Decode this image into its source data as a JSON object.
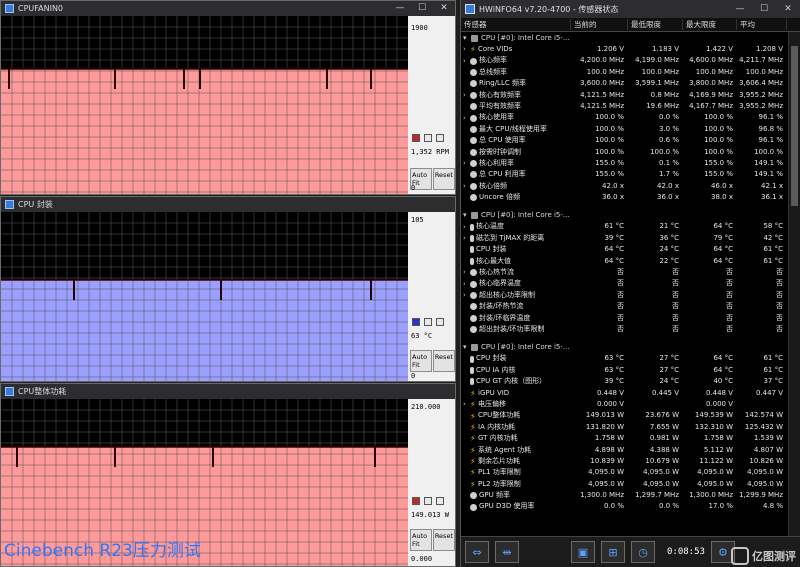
{
  "graphs": [
    {
      "title": "CPUFANIN0",
      "scale_max": "1900",
      "current": "1,352 RPM",
      "scale_min": "0",
      "color": "#ff9a9a",
      "level": 0.7,
      "spikes": [
        0.02,
        0.28,
        0.45,
        0.49,
        0.8,
        0.91
      ]
    },
    {
      "title": "CPU 封装",
      "scale_max": "105",
      "current": "63 °C",
      "scale_min": "0",
      "color": "#9ba0ff",
      "level": 0.6,
      "spikes": [
        0.18,
        0.54,
        0.91
      ]
    },
    {
      "title": "CPU整体功耗",
      "scale_max": "210.000",
      "current": "149.013 W",
      "scale_min": "0.000",
      "color": "#ff9a9a",
      "level": 0.71,
      "spikes": [
        0.04,
        0.28,
        0.52,
        0.92
      ]
    }
  ],
  "graph_buttons": {
    "autofit": "Auto Fit",
    "reset": "Reset"
  },
  "sensor_window": {
    "title": "HWiNFO64 v7.20-4700 - 传感器状态",
    "columns": [
      "传感器",
      "当前的",
      "最低限度",
      "最大限度",
      "平均"
    ],
    "groups": [
      {
        "header": "CPU [#0]: Intel Core i5-...",
        "rows": [
          {
            "icon": "volt",
            "label": "Core VIDs",
            "expand": true,
            "v": [
              "1.206 V",
              "1.183 V",
              "1.422 V",
              "1.208 V"
            ]
          },
          {
            "icon": "circle",
            "label": "核心频率",
            "expand": true,
            "v": [
              "4,200.0 MHz",
              "4,199.0 MHz",
              "4,600.0 MHz",
              "4,211.7 MHz"
            ]
          },
          {
            "icon": "circle",
            "label": "总线频率",
            "expand": false,
            "v": [
              "100.0 MHz",
              "100.0 MHz",
              "100.0 MHz",
              "100.0 MHz"
            ]
          },
          {
            "icon": "circle",
            "label": "Ring/LLC 频率",
            "expand": false,
            "v": [
              "3,600.0 MHz",
              "3,599.1 MHz",
              "3,800.0 MHz",
              "3,606.4 MHz"
            ]
          },
          {
            "icon": "circle",
            "label": "核心有效频率",
            "expand": true,
            "v": [
              "4,121.5 MHz",
              "0.8 MHz",
              "4,169.9 MHz",
              "3,955.2 MHz"
            ]
          },
          {
            "icon": "circle",
            "label": "平均有效频率",
            "expand": false,
            "v": [
              "4,121.5 MHz",
              "19.6 MHz",
              "4,167.7 MHz",
              "3,955.2 MHz"
            ]
          },
          {
            "icon": "circle",
            "label": "核心使用率",
            "expand": true,
            "v": [
              "100.0 %",
              "0.0 %",
              "100.0 %",
              "96.1 %"
            ]
          },
          {
            "icon": "circle",
            "label": "最大 CPU/线程使用率",
            "expand": false,
            "v": [
              "100.0 %",
              "3.0 %",
              "100.0 %",
              "96.8 %"
            ]
          },
          {
            "icon": "circle",
            "label": "总 CPU 使用率",
            "expand": false,
            "v": [
              "100.0 %",
              "0.6 %",
              "100.0 %",
              "96.1 %"
            ]
          },
          {
            "icon": "circle",
            "label": "按需时钟调制",
            "expand": false,
            "v": [
              "100.0 %",
              "100.0 %",
              "100.0 %",
              "100.0 %"
            ]
          },
          {
            "icon": "circle",
            "label": "核心利用率",
            "expand": true,
            "v": [
              "155.0 %",
              "0.1 %",
              "155.0 %",
              "149.1 %"
            ]
          },
          {
            "icon": "circle",
            "label": "总 CPU 利用率",
            "expand": false,
            "v": [
              "155.0 %",
              "1.7 %",
              "155.0 %",
              "149.1 %"
            ]
          },
          {
            "icon": "circle",
            "label": "核心倍频",
            "expand": true,
            "v": [
              "42.0 x",
              "42.0 x",
              "46.0 x",
              "42.1 x"
            ]
          },
          {
            "icon": "circle",
            "label": "Uncore 倍频",
            "expand": false,
            "v": [
              "36.0 x",
              "36.0 x",
              "38.0 x",
              "36.1 x"
            ]
          }
        ]
      },
      {
        "header": "CPU [#0]: Intel Core i5-...",
        "rows": [
          {
            "icon": "therm",
            "label": "核心温度",
            "expand": true,
            "v": [
              "61 °C",
              "21 °C",
              "64 °C",
              "58 °C"
            ]
          },
          {
            "icon": "therm",
            "label": "磁芯到 TjMAX 的距离",
            "expand": true,
            "v": [
              "39 °C",
              "36 °C",
              "79 °C",
              "42 °C"
            ]
          },
          {
            "icon": "therm",
            "label": "CPU 封装",
            "expand": false,
            "v": [
              "64 °C",
              "24 °C",
              "64 °C",
              "61 °C"
            ]
          },
          {
            "icon": "therm",
            "label": "核心最大值",
            "expand": false,
            "v": [
              "64 °C",
              "22 °C",
              "64 °C",
              "61 °C"
            ]
          },
          {
            "icon": "circle",
            "label": "核心热节流",
            "expand": true,
            "v": [
              "否",
              "否",
              "否",
              "否"
            ]
          },
          {
            "icon": "circle",
            "label": "核心临界温度",
            "expand": true,
            "v": [
              "否",
              "否",
              "否",
              "否"
            ]
          },
          {
            "icon": "circle",
            "label": "超出核心功率限制",
            "expand": true,
            "v": [
              "否",
              "否",
              "否",
              "否"
            ]
          },
          {
            "icon": "circle",
            "label": "封装/环热节流",
            "expand": false,
            "v": [
              "否",
              "否",
              "否",
              "否"
            ]
          },
          {
            "icon": "circle",
            "label": "封装/环临界温度",
            "expand": false,
            "v": [
              "否",
              "否",
              "否",
              "否"
            ]
          },
          {
            "icon": "circle",
            "label": "超出封装/环功率限制",
            "expand": false,
            "v": [
              "否",
              "否",
              "否",
              "否"
            ]
          }
        ]
      },
      {
        "header": "CPU [#0]: Intel Core i5-...",
        "rows": [
          {
            "icon": "therm",
            "label": "CPU 封装",
            "expand": false,
            "v": [
              "63 °C",
              "27 °C",
              "64 °C",
              "61 °C"
            ]
          },
          {
            "icon": "therm",
            "label": "CPU IA 内核",
            "expand": false,
            "v": [
              "63 °C",
              "27 °C",
              "64 °C",
              "61 °C"
            ]
          },
          {
            "icon": "therm",
            "label": "CPU GT 内核（图形）",
            "expand": false,
            "v": [
              "39 °C",
              "24 °C",
              "40 °C",
              "37 °C"
            ]
          },
          {
            "icon": "volt",
            "label": "iGPU VID",
            "expand": false,
            "v": [
              "0.448 V",
              "0.445 V",
              "0.448 V",
              "0.447 V"
            ]
          },
          {
            "icon": "volt",
            "label": "电压偏移",
            "expand": true,
            "v": [
              "0.000 V",
              "",
              "0.000 V",
              ""
            ]
          },
          {
            "icon": "volt",
            "label": "CPU整体功耗",
            "expand": false,
            "v": [
              "149.013 W",
              "23.676 W",
              "149.539 W",
              "142.574 W"
            ]
          },
          {
            "icon": "volt",
            "label": "IA 内核功耗",
            "expand": false,
            "v": [
              "131.820 W",
              "7.655 W",
              "132.310 W",
              "125.432 W"
            ]
          },
          {
            "icon": "volt",
            "label": "GT 内核功耗",
            "expand": false,
            "v": [
              "1.758 W",
              "0.981 W",
              "1.758 W",
              "1.539 W"
            ]
          },
          {
            "icon": "volt",
            "label": "系统 Agent 功耗",
            "expand": false,
            "v": [
              "4.898 W",
              "4.388 W",
              "5.112 W",
              "4.807 W"
            ]
          },
          {
            "icon": "volt",
            "label": "剩余芯片功耗",
            "expand": false,
            "v": [
              "10.839 W",
              "10.679 W",
              "11.122 W",
              "10.826 W"
            ]
          },
          {
            "icon": "volt",
            "label": "PL1 功率限制",
            "expand": false,
            "v": [
              "4,095.0 W",
              "4,095.0 W",
              "4,095.0 W",
              "4,095.0 W"
            ]
          },
          {
            "icon": "volt",
            "label": "PL2 功率限制",
            "expand": false,
            "v": [
              "4,095.0 W",
              "4,095.0 W",
              "4,095.0 W",
              "4,095.0 W"
            ]
          },
          {
            "icon": "circle",
            "label": "GPU 频率",
            "expand": false,
            "v": [
              "1,300.0 MHz",
              "1,299.7 MHz",
              "1,300.0 MHz",
              "1,299.9 MHz"
            ]
          },
          {
            "icon": "circle",
            "label": "GPU D3D 使用率",
            "expand": false,
            "v": [
              "0.0 %",
              "0.0 %",
              "17.0 %",
              "4.8 %"
            ]
          }
        ]
      }
    ],
    "footer": {
      "time": "0:08:53"
    }
  },
  "caption": "Cinebench R23压力测试",
  "watermark": "亿图测评",
  "colors": {
    "fan_red": "#ff9a9a",
    "temp_blue": "#9ba0ff",
    "volt_yellow": "#f2c200",
    "caption_blue": "#2d77ff"
  },
  "icons": {
    "fan_graph_swatches": [
      "red-square",
      "gray-square",
      "gray-square"
    ],
    "temp_graph_swatches": [
      "blue-square",
      "gray-square",
      "gray-square"
    ],
    "power_graph_swatches": [
      "red-square",
      "gray-square",
      "gray-square"
    ]
  }
}
